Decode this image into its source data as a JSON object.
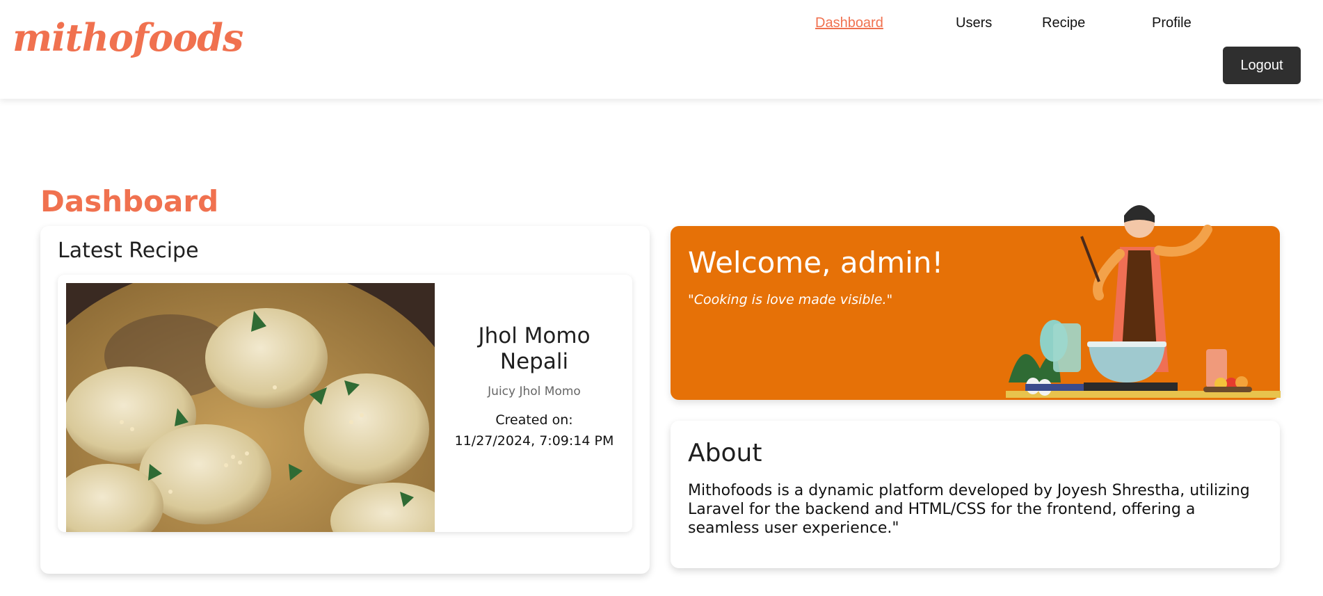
{
  "header": {
    "logo": "mithofoods",
    "nav": [
      {
        "label": "Dashboard"
      },
      {
        "label": "Users"
      },
      {
        "label": "Recipe"
      },
      {
        "label": "Profile"
      }
    ],
    "logout_label": "Logout"
  },
  "page": {
    "title": "Dashboard"
  },
  "latest_recipe": {
    "heading": "Latest Recipe",
    "name": "Jhol Momo Nepali",
    "description": "Juicy Jhol Momo",
    "created_label": "Created on:",
    "created_value": "11/27/2024, 7:09:14 PM"
  },
  "welcome": {
    "title": "Welcome, admin!",
    "quote": "\"Cooking is love made visible.\""
  },
  "about": {
    "title": "About",
    "text": "Mithofoods is a dynamic platform developed by Joyesh Shrestha, utilizing Laravel for the backend and HTML/CSS for the frontend, offering a seamless user experience.\""
  },
  "colors": {
    "accent": "#f0714f",
    "banner": "#e67107",
    "button": "#2f2f2f"
  }
}
